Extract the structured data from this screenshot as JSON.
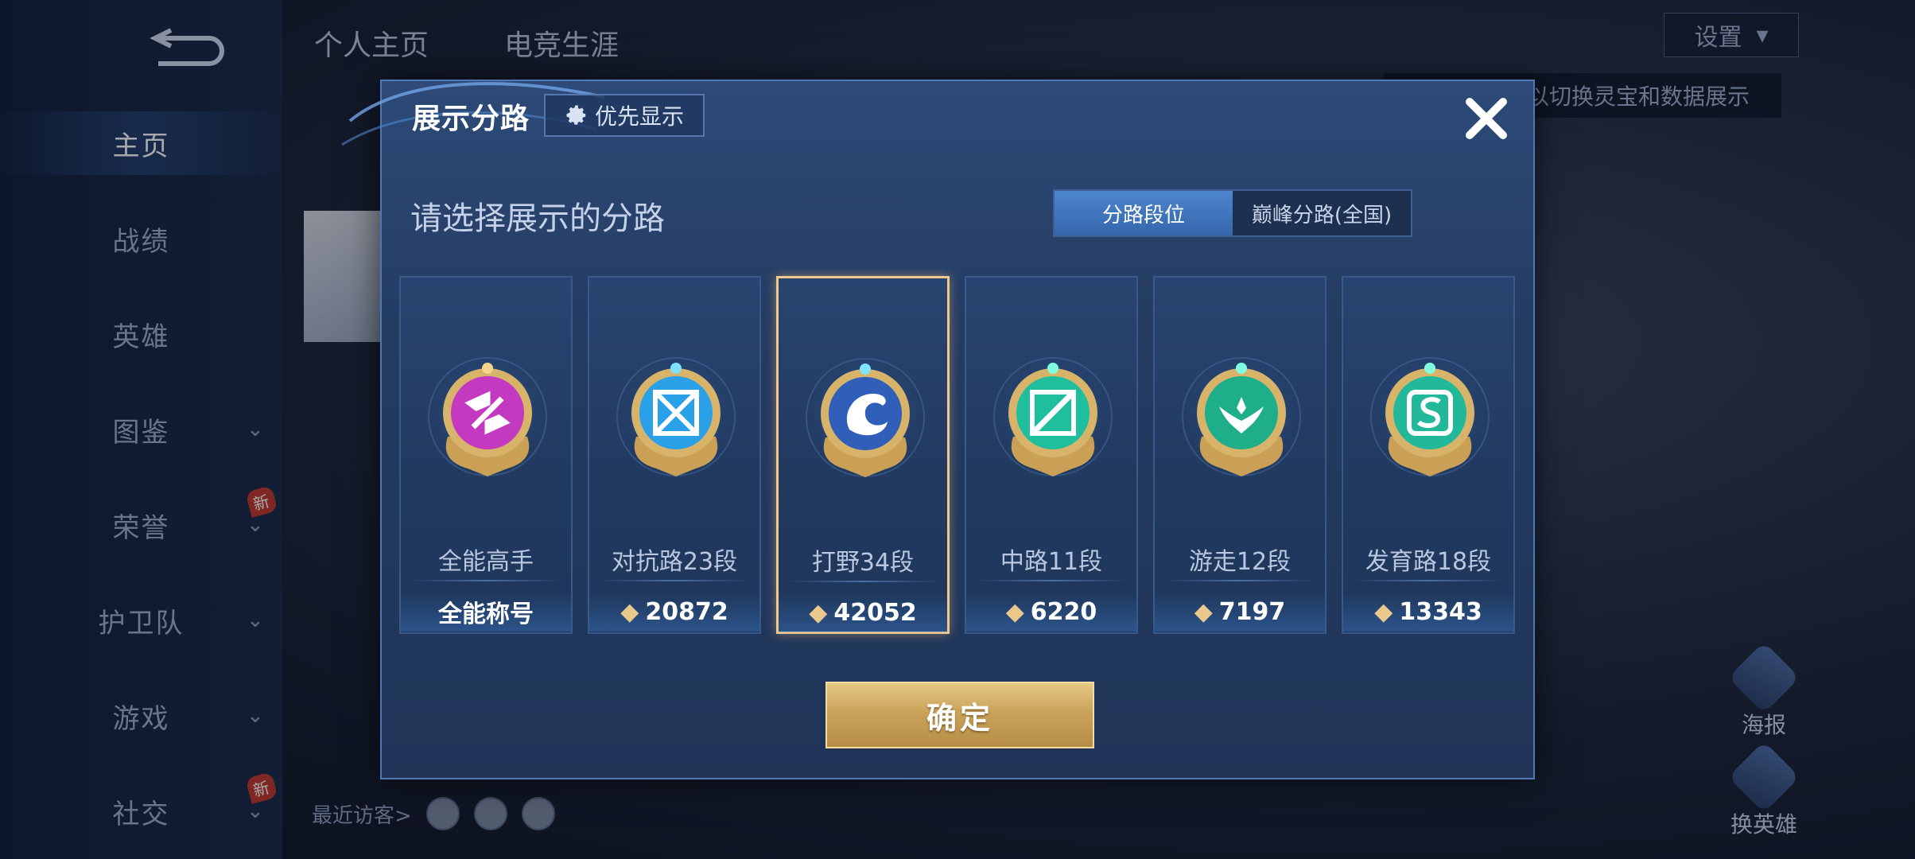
{
  "sidebar": {
    "items": [
      {
        "label": "主页",
        "active": true
      },
      {
        "label": "战绩"
      },
      {
        "label": "英雄"
      },
      {
        "label": "图鉴",
        "chevron": true
      },
      {
        "label": "荣誉",
        "chevron": true,
        "badge": "新"
      },
      {
        "label": "护卫队",
        "chevron": true
      },
      {
        "label": "游戏",
        "chevron": true
      },
      {
        "label": "社交",
        "chevron": true,
        "badge": "新"
      }
    ]
  },
  "header": {
    "tabs": [
      "个人主页",
      "电竞生涯"
    ],
    "settings_label": "设置"
  },
  "background_hint": "以切换灵宝和数据展示",
  "visitors_label": "最近访客>",
  "right_buttons": [
    {
      "label": "海报"
    },
    {
      "label": "换英雄"
    }
  ],
  "modal": {
    "title": "展示分路",
    "priority_button": "优先显示",
    "subtitle": "请选择展示的分路",
    "toggle": [
      "分路段位",
      "巅峰分路(全国)"
    ],
    "toggle_selected": 0,
    "cards": [
      {
        "name": "全能高手",
        "value": "全能称号",
        "color": "#c33ac0",
        "icon": "all-round-icon",
        "show_gem": false
      },
      {
        "name": "对抗路23段",
        "value": "20872",
        "color": "#2aa0e8",
        "icon": "clash-lane-icon",
        "show_gem": true
      },
      {
        "name": "打野34段",
        "value": "42052",
        "color": "#2f5fb8",
        "icon": "jungle-dragon-icon",
        "show_gem": true,
        "selected": true
      },
      {
        "name": "中路11段",
        "value": "6220",
        "color": "#1fbf9e",
        "icon": "mid-lane-icon",
        "show_gem": true
      },
      {
        "name": "游走12段",
        "value": "7197",
        "color": "#1fae8a",
        "icon": "roam-icon",
        "show_gem": true
      },
      {
        "name": "发育路18段",
        "value": "13343",
        "color": "#22b89a",
        "icon": "farm-lane-icon",
        "show_gem": true
      }
    ],
    "confirm_label": "确定"
  }
}
